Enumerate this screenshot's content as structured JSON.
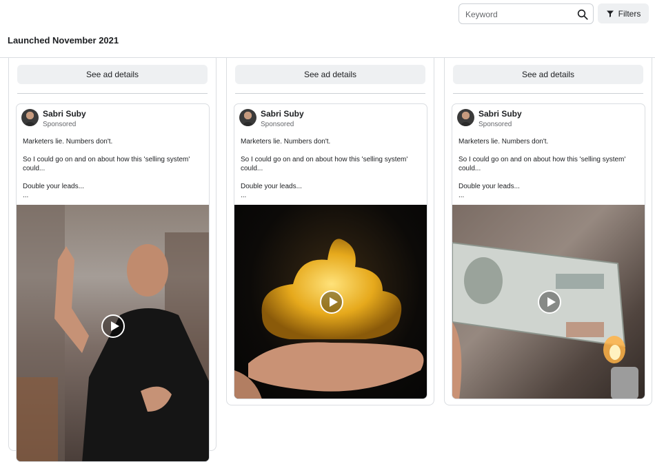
{
  "header": {
    "search_placeholder": "Keyword",
    "filters_label": "Filters",
    "section_title": "Launched November 2021"
  },
  "ads": [
    {
      "details_label": "See ad details",
      "page_name": "Sabri Suby",
      "sponsored_label": "Sponsored",
      "body": [
        "Marketers lie. Numbers don't.",
        "So I could go on and on about how this 'selling system' could...",
        "Double your leads...",
        "..."
      ],
      "media_icon": "play-icon"
    },
    {
      "details_label": "See ad details",
      "page_name": "Sabri Suby",
      "sponsored_label": "Sponsored",
      "body": [
        "Marketers lie. Numbers don't.",
        "So I could go on and on about how this 'selling system' could...",
        "Double your leads...",
        "..."
      ],
      "media_icon": "play-icon"
    },
    {
      "details_label": "See ad details",
      "page_name": "Sabri Suby",
      "sponsored_label": "Sponsored",
      "body": [
        "Marketers lie. Numbers don't.",
        "So I could go on and on about how this 'selling system' could...",
        "Double your leads...",
        "..."
      ],
      "media_icon": "play-icon"
    }
  ],
  "colors": {
    "button_bg": "#eef0f2",
    "text": "#1c1e21",
    "muted": "#65676b",
    "border": "#dadde1"
  }
}
